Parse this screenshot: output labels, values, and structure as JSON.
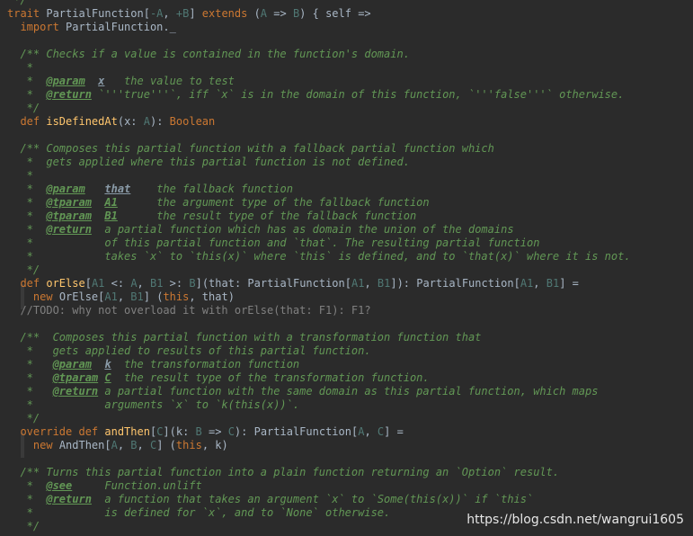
{
  "lines": [
    [
      {
        "s": "c",
        "t": " */"
      }
    ],
    [
      {
        "s": "k",
        "t": "trait "
      },
      {
        "s": "d",
        "t": "PartialFunction["
      },
      {
        "s": "tp",
        "t": "-A"
      },
      {
        "s": "d",
        "t": ", "
      },
      {
        "s": "tp",
        "t": "+B"
      },
      {
        "s": "d",
        "t": "] "
      },
      {
        "s": "k",
        "t": "extends "
      },
      {
        "s": "d",
        "t": "("
      },
      {
        "s": "tp",
        "t": "A"
      },
      {
        "s": "d",
        "t": " => "
      },
      {
        "s": "tp",
        "t": "B"
      },
      {
        "s": "d",
        "t": ") { self =>"
      }
    ],
    [
      {
        "s": "d",
        "t": "  "
      },
      {
        "s": "k",
        "t": "import "
      },
      {
        "s": "d",
        "t": "PartialFunction._"
      }
    ],
    [
      {
        "s": "d",
        "t": ""
      }
    ],
    [
      {
        "s": "c",
        "t": "  /** Checks if a value is contained in the function's domain."
      }
    ],
    [
      {
        "s": "c",
        "t": "   *"
      }
    ],
    [
      {
        "s": "c",
        "t": "   *  "
      },
      {
        "s": "ct",
        "t": "@param"
      },
      {
        "s": "c",
        "t": "  "
      },
      {
        "s": "cn",
        "t": "x"
      },
      {
        "s": "c",
        "t": "   the value to test"
      }
    ],
    [
      {
        "s": "c",
        "t": "   *  "
      },
      {
        "s": "ct",
        "t": "@return"
      },
      {
        "s": "c",
        "t": " `'''true'''`, iff `x` is in the domain of this function, `'''false'''` otherwise."
      }
    ],
    [
      {
        "s": "c",
        "t": "   */"
      }
    ],
    [
      {
        "s": "d",
        "t": "  "
      },
      {
        "s": "k",
        "t": "def "
      },
      {
        "s": "f",
        "t": "isDefinedAt"
      },
      {
        "s": "d",
        "t": "(x: "
      },
      {
        "s": "tp",
        "t": "A"
      },
      {
        "s": "d",
        "t": "): "
      },
      {
        "s": "k",
        "t": "Boolean"
      }
    ],
    [
      {
        "s": "d",
        "t": ""
      }
    ],
    [
      {
        "s": "c",
        "t": "  /** Composes this partial function with a fallback partial function which"
      }
    ],
    [
      {
        "s": "c",
        "t": "   *  gets applied where this partial function is not defined."
      }
    ],
    [
      {
        "s": "c",
        "t": "   *"
      }
    ],
    [
      {
        "s": "c",
        "t": "   *  "
      },
      {
        "s": "ct",
        "t": "@param"
      },
      {
        "s": "c",
        "t": "   "
      },
      {
        "s": "cn",
        "t": "that"
      },
      {
        "s": "c",
        "t": "    the fallback function"
      }
    ],
    [
      {
        "s": "c",
        "t": "   *  "
      },
      {
        "s": "ct",
        "t": "@tparam"
      },
      {
        "s": "c",
        "t": "  "
      },
      {
        "s": "ct",
        "t": "A1"
      },
      {
        "s": "c",
        "t": "      the argument type of the fallback function"
      }
    ],
    [
      {
        "s": "c",
        "t": "   *  "
      },
      {
        "s": "ct",
        "t": "@tparam"
      },
      {
        "s": "c",
        "t": "  "
      },
      {
        "s": "ct",
        "t": "B1"
      },
      {
        "s": "c",
        "t": "      the result type of the fallback function"
      }
    ],
    [
      {
        "s": "c",
        "t": "   *  "
      },
      {
        "s": "ct",
        "t": "@return"
      },
      {
        "s": "c",
        "t": "  a partial function which has as domain the union of the domains"
      }
    ],
    [
      {
        "s": "c",
        "t": "   *           of this partial function and `that`. The resulting partial function"
      }
    ],
    [
      {
        "s": "c",
        "t": "   *           takes `x` to `this(x)` where `this` is defined, and to `that(x)` where it is not."
      }
    ],
    [
      {
        "s": "c",
        "t": "   */"
      }
    ],
    [
      {
        "s": "d",
        "t": "  "
      },
      {
        "s": "k",
        "t": "def "
      },
      {
        "s": "f",
        "t": "orElse"
      },
      {
        "s": "d",
        "t": "["
      },
      {
        "s": "tp",
        "t": "A1"
      },
      {
        "s": "d",
        "t": " <: "
      },
      {
        "s": "tp",
        "t": "A"
      },
      {
        "s": "d",
        "t": ", "
      },
      {
        "s": "tp",
        "t": "B1"
      },
      {
        "s": "d",
        "t": " >: "
      },
      {
        "s": "tp",
        "t": "B"
      },
      {
        "s": "d",
        "t": "](that: PartialFunction["
      },
      {
        "s": "tp",
        "t": "A1"
      },
      {
        "s": "d",
        "t": ", "
      },
      {
        "s": "tp",
        "t": "B1"
      },
      {
        "s": "d",
        "t": "]): PartialFunction["
      },
      {
        "s": "tp",
        "t": "A1"
      },
      {
        "s": "d",
        "t": ", "
      },
      {
        "s": "tp",
        "t": "B1"
      },
      {
        "s": "d",
        "t": "] ="
      }
    ],
    [
      {
        "s": "d",
        "t": "    "
      },
      {
        "s": "k",
        "t": "new "
      },
      {
        "s": "d",
        "t": "OrElse["
      },
      {
        "s": "tp",
        "t": "A1"
      },
      {
        "s": "d",
        "t": ", "
      },
      {
        "s": "tp",
        "t": "B1"
      },
      {
        "s": "d",
        "t": "] ("
      },
      {
        "s": "k",
        "t": "this"
      },
      {
        "s": "d",
        "t": ", that)"
      }
    ],
    [
      {
        "s": "lc",
        "t": "  //TODO: why not overload it with orElse(that: F1): F1?"
      }
    ],
    [
      {
        "s": "d",
        "t": ""
      }
    ],
    [
      {
        "s": "c",
        "t": "  /**  Composes this partial function with a transformation function that"
      }
    ],
    [
      {
        "s": "c",
        "t": "   *   gets applied to results of this partial function."
      }
    ],
    [
      {
        "s": "c",
        "t": "   *   "
      },
      {
        "s": "ct",
        "t": "@param"
      },
      {
        "s": "c",
        "t": "  "
      },
      {
        "s": "cn",
        "t": "k"
      },
      {
        "s": "c",
        "t": "  the transformation function"
      }
    ],
    [
      {
        "s": "c",
        "t": "   *   "
      },
      {
        "s": "ct",
        "t": "@tparam"
      },
      {
        "s": "c",
        "t": " "
      },
      {
        "s": "ct",
        "t": "C"
      },
      {
        "s": "c",
        "t": "  the result type of the transformation function."
      }
    ],
    [
      {
        "s": "c",
        "t": "   *   "
      },
      {
        "s": "ct",
        "t": "@return"
      },
      {
        "s": "c",
        "t": " a partial function with the same domain as this partial function, which maps"
      }
    ],
    [
      {
        "s": "c",
        "t": "   *           arguments `x` to `k(this(x))`."
      }
    ],
    [
      {
        "s": "c",
        "t": "   */"
      }
    ],
    [
      {
        "s": "d",
        "t": "  "
      },
      {
        "s": "k",
        "t": "override def "
      },
      {
        "s": "f",
        "t": "andThen"
      },
      {
        "s": "d",
        "t": "["
      },
      {
        "s": "tp",
        "t": "C"
      },
      {
        "s": "d",
        "t": "](k: "
      },
      {
        "s": "tp",
        "t": "B"
      },
      {
        "s": "d",
        "t": " => "
      },
      {
        "s": "tp",
        "t": "C"
      },
      {
        "s": "d",
        "t": "): PartialFunction["
      },
      {
        "s": "tp",
        "t": "A"
      },
      {
        "s": "d",
        "t": ", "
      },
      {
        "s": "tp",
        "t": "C"
      },
      {
        "s": "d",
        "t": "] ="
      }
    ],
    [
      {
        "s": "d",
        "t": "    "
      },
      {
        "s": "k",
        "t": "new "
      },
      {
        "s": "d",
        "t": "AndThen["
      },
      {
        "s": "tp",
        "t": "A"
      },
      {
        "s": "d",
        "t": ", "
      },
      {
        "s": "tp",
        "t": "B"
      },
      {
        "s": "d",
        "t": ", "
      },
      {
        "s": "tp",
        "t": "C"
      },
      {
        "s": "d",
        "t": "] ("
      },
      {
        "s": "k",
        "t": "this"
      },
      {
        "s": "d",
        "t": ", k)"
      }
    ],
    [
      {
        "s": "d",
        "t": ""
      }
    ],
    [
      {
        "s": "c",
        "t": "  /** Turns this partial function into a plain function returning an `Option` result."
      }
    ],
    [
      {
        "s": "c",
        "t": "   *  "
      },
      {
        "s": "ct",
        "t": "@see"
      },
      {
        "s": "c",
        "t": "     Function.unlift"
      }
    ],
    [
      {
        "s": "c",
        "t": "   *  "
      },
      {
        "s": "ct",
        "t": "@return"
      },
      {
        "s": "c",
        "t": "  a function that takes an argument `x` to `Some(this(x))` if `this`"
      }
    ],
    [
      {
        "s": "c",
        "t": "   *           is defined for `x`, and to `None` otherwise."
      }
    ],
    [
      {
        "s": "c",
        "t": "   */"
      }
    ]
  ],
  "watermark": "https://blog.csdn.net/wangrui1605"
}
